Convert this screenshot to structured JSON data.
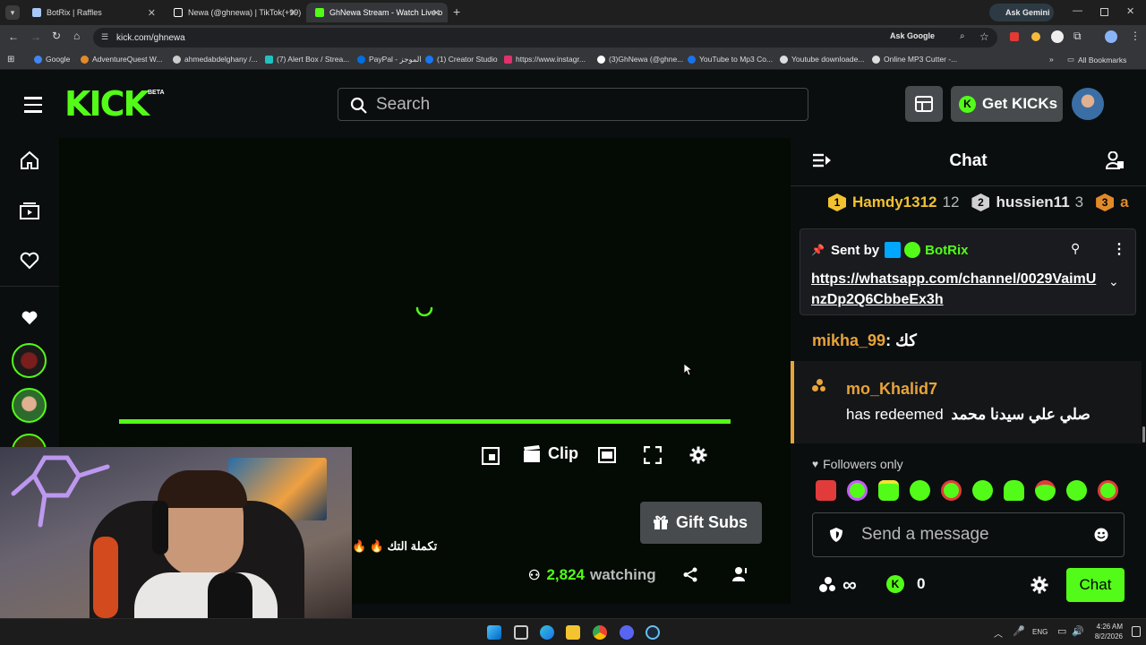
{
  "browser": {
    "tabs": [
      {
        "title": "BotRix | Raffles",
        "color": "#a8c7fa"
      },
      {
        "title": "Newa (@ghnewa) | TikTok(+99)",
        "color": "#ffffff"
      },
      {
        "title": "GhNewa Stream - Watch Live o",
        "color": "#53fc18"
      }
    ],
    "url": "kick.com/ghnewa",
    "ask_gemini": "Ask Gemini",
    "ask_google": "Ask Google",
    "bookmarks": [
      {
        "label": "Google",
        "color": "#4285f4"
      },
      {
        "label": "AdventureQuest W...",
        "color": "#e08a2a"
      },
      {
        "label": "ahmedabdelghany /...",
        "color": "#cccccc"
      },
      {
        "label": "(7) Alert Box / Strea...",
        "color": "#21c1c1"
      },
      {
        "label": "PayPal - الموجز",
        "color": "#0070e0"
      },
      {
        "label": "(1) Creator Studio",
        "color": "#1877f2"
      },
      {
        "label": "https://www.instagr...",
        "color": "#e1306c"
      },
      {
        "label": "(3)GhNewa (@ghne...",
        "color": "#ffffff"
      },
      {
        "label": "YouTube to Mp3 Co...",
        "color": "#1a73e8"
      },
      {
        "label": "Youtube downloade...",
        "color": "#dddddd"
      },
      {
        "label": "Online MP3 Cutter -...",
        "color": "#dddddd"
      }
    ],
    "all_bookmarks": "All Bookmarks"
  },
  "header": {
    "logo": "KICK",
    "beta": "BETA",
    "search_placeholder": "Search",
    "get_kicks": "Get KICKs"
  },
  "player": {
    "clip_label": "Clip",
    "gift_subs": "Gift Subs",
    "title_fragment": "تكملة التك 🔥 🔥",
    "viewers": "2,824",
    "watching": "watching",
    "progress": 1.0
  },
  "chat": {
    "title": "Chat",
    "leaderboard": [
      {
        "rank": "1",
        "name": "Hamdy1312",
        "count": "12",
        "color": "#f2c230"
      },
      {
        "rank": "2",
        "name": "hussien11",
        "count": "3",
        "color": "#d0d0d0"
      },
      {
        "rank": "3",
        "name": "a",
        "count": "",
        "color": "#e08a2a"
      }
    ],
    "pinned": {
      "sent_by": "Sent by",
      "sender": "BotRix",
      "link": "https://whatsapp.com/channel/0029VaimUnzDp2Q6CbbeEx3h"
    },
    "messages": [
      {
        "user": "mikha_99",
        "text": "كك",
        "color": "#e8a33a"
      }
    ],
    "redeem": {
      "user": "mo_Khalid7",
      "action": "has redeemed",
      "reward": "صلي علي سيدنا محمد"
    },
    "followers_only": "Followers only",
    "input_placeholder": "Send a message",
    "points": "∞",
    "kicks": "0",
    "send_label": "Chat"
  },
  "taskbar": {
    "lang": "ENG",
    "time": "4:26 AM",
    "date": "8/2/2026"
  }
}
